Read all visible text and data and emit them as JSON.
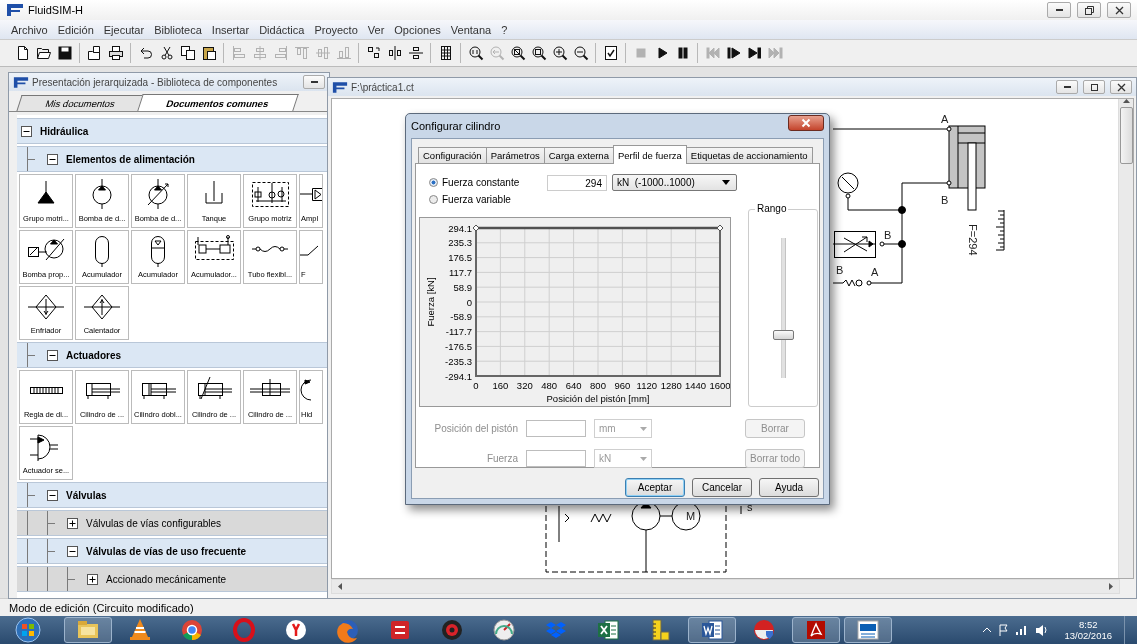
{
  "app": {
    "title": "FluidSIM-H",
    "menu": [
      "Archivo",
      "Edición",
      "Ejecutar",
      "Biblioteca",
      "Insertar",
      "Didáctica",
      "Proyecto",
      "Ver",
      "Opciones",
      "Ventana",
      "?"
    ]
  },
  "toolbar": [
    [
      {
        "kind": "new",
        "disabled": false
      },
      {
        "kind": "open",
        "disabled": false
      },
      {
        "kind": "save",
        "disabled": false
      }
    ],
    [
      {
        "kind": "import",
        "disabled": false
      },
      {
        "kind": "print",
        "disabled": false
      }
    ],
    [
      {
        "kind": "undo",
        "disabled": false
      },
      {
        "kind": "cut",
        "disabled": false
      },
      {
        "kind": "copy",
        "disabled": false
      },
      {
        "kind": "paste",
        "disabled": false
      }
    ],
    [
      {
        "kind": "align-left",
        "disabled": true
      },
      {
        "kind": "align-center",
        "disabled": true
      },
      {
        "kind": "align-right",
        "disabled": true
      },
      {
        "kind": "align-top",
        "disabled": true
      },
      {
        "kind": "align-middle",
        "disabled": true
      },
      {
        "kind": "align-bottom",
        "disabled": true
      }
    ],
    [
      {
        "kind": "rotate",
        "disabled": false
      },
      {
        "kind": "flip-h",
        "disabled": false
      },
      {
        "kind": "flip-v",
        "disabled": false
      }
    ],
    [
      {
        "kind": "grid",
        "disabled": false
      }
    ],
    [
      {
        "kind": "zoom-actual",
        "disabled": false
      },
      {
        "kind": "zoom-previous",
        "disabled": true
      },
      {
        "kind": "zoom-window",
        "disabled": false
      },
      {
        "kind": "zoom-page",
        "disabled": false
      },
      {
        "kind": "zoom-in",
        "disabled": false
      },
      {
        "kind": "zoom-out",
        "disabled": false
      }
    ],
    [
      {
        "kind": "check",
        "disabled": false
      }
    ],
    [
      {
        "kind": "stop",
        "disabled": true
      },
      {
        "kind": "play",
        "disabled": false
      },
      {
        "kind": "pause",
        "disabled": false
      }
    ],
    [
      {
        "kind": "reset",
        "disabled": true
      },
      {
        "kind": "step",
        "disabled": false
      },
      {
        "kind": "step-end",
        "disabled": false
      },
      {
        "kind": "end",
        "disabled": true
      }
    ]
  ],
  "library": {
    "title": "Presentación jerarquizada - Biblioteca de componentes",
    "tabs": [
      {
        "label": "Mis documentos",
        "selected": false
      },
      {
        "label": "Documentos comunes",
        "selected": true
      }
    ],
    "tree": [
      {
        "label": "Hidráulica",
        "expanded": true,
        "children": [
          {
            "label": "Elementos de alimentación",
            "expanded": true,
            "tiles": [
              {
                "label": "Grupo motri...",
                "kind": "power-unit",
                "cut": false
              },
              {
                "label": "Bomba de d...",
                "kind": "pump",
                "cut": false
              },
              {
                "label": "Bomba de d...",
                "kind": "variable-pump",
                "cut": false
              },
              {
                "label": "Tanque",
                "kind": "tank",
                "cut": false
              },
              {
                "label": "Grupo motriz",
                "kind": "power-unit-circuit",
                "cut": false
              },
              {
                "label": "Ampl",
                "kind": "amplifier",
                "cut": true
              },
              {
                "label": "Bomba prop...",
                "kind": "proportional-pump",
                "cut": false
              },
              {
                "label": "Acumulador",
                "kind": "accumulator",
                "cut": false
              },
              {
                "label": "Acumulador",
                "kind": "gas-accumulator",
                "cut": false
              },
              {
                "label": "Acumulador...",
                "kind": "accumulator-circuit",
                "cut": false
              },
              {
                "label": "Tubo flexibl...",
                "kind": "hose",
                "cut": false
              },
              {
                "label": "F",
                "kind": "filter",
                "cut": true
              },
              {
                "label": "Enfriador",
                "kind": "cooler",
                "cut": false
              },
              {
                "label": "Calentador",
                "kind": "heater",
                "cut": false
              }
            ]
          },
          {
            "label": "Actuadores",
            "expanded": true,
            "tiles": [
              {
                "label": "Regla de di...",
                "kind": "ruler",
                "cut": false
              },
              {
                "label": "Cilindro de ...",
                "kind": "cylinder",
                "cut": false
              },
              {
                "label": "Cilindro dobl...",
                "kind": "double-cylinder",
                "cut": false
              },
              {
                "label": "Cilindro de ...",
                "kind": "cushion-cylinder",
                "cut": false
              },
              {
                "label": "Cilindro de ...",
                "kind": "through-rod-cylinder",
                "cut": false
              },
              {
                "label": "Hid",
                "kind": "motor",
                "cut": true
              },
              {
                "label": "Actuador se...",
                "kind": "semi-rotary",
                "cut": false
              }
            ]
          },
          {
            "label": "Válvulas",
            "expanded": true,
            "children": [
              {
                "label": "Válvulas de vías configurables",
                "expanded": false
              },
              {
                "label": "Válvulas de vías de uso frecuente",
                "expanded": true,
                "children": [
                  {
                    "label": "Accionado mecánicamente",
                    "expanded": false
                  }
                ]
              }
            ]
          }
        ]
      }
    ]
  },
  "circuit_window": {
    "title": "F:\\práctica1.ct",
    "labels": [
      "A",
      "B",
      "F=294",
      "B",
      "B",
      "A",
      "M",
      "s"
    ]
  },
  "dialog": {
    "title": "Configurar cilindro",
    "tabs": [
      {
        "label": "Configuración",
        "selected": false
      },
      {
        "label": "Parámetros",
        "selected": false
      },
      {
        "label": "Carga externa",
        "selected": false
      },
      {
        "label": "Perfil de fuerza",
        "selected": true
      },
      {
        "label": "Etiquetas de accionamiento",
        "selected": false
      }
    ],
    "force_mode": [
      {
        "label": "Fuerza constante",
        "selected": true
      },
      {
        "label": "Fuerza variable",
        "selected": false
      }
    ],
    "force_value": "294",
    "unit_select": "kN  (-1000..1000)",
    "chart_data": {
      "type": "line",
      "xlabel": "Posición del pistón [mm]",
      "ylabel": "Fuerza [kN]",
      "x": [
        0,
        1600
      ],
      "series": [
        {
          "color": "#505050",
          "marker": "diamond",
          "values": [
            294,
            294
          ]
        }
      ],
      "grid": true,
      "xlim": [
        0,
        1600
      ],
      "ylim": [
        -294.1,
        294.1
      ],
      "xticks": [
        0,
        160,
        320,
        480,
        640,
        800,
        960,
        1120,
        1280,
        1440,
        1600
      ],
      "yticks": [
        294.1,
        235.3,
        176.5,
        117.7,
        58.9,
        0,
        -58.9,
        -117.7,
        -176.5,
        -235.3,
        -294.1
      ]
    },
    "range": {
      "label": "Rango",
      "level": 0.3
    },
    "point_fields": [
      {
        "label": "Posición del pistón",
        "unit": "mm",
        "disabled": true
      },
      {
        "label": "Fuerza",
        "unit": "kN",
        "disabled": true
      }
    ],
    "point_buttons": [
      {
        "label": "Borrar",
        "disabled": true
      },
      {
        "label": "Borrar todo",
        "disabled": true
      }
    ],
    "buttons": [
      {
        "label": "Aceptar",
        "default": true
      },
      {
        "label": "Cancelar",
        "default": false
      },
      {
        "label": "Ayuda",
        "default": false
      }
    ]
  },
  "status_bar": "Modo de edición (Circuito modificado)",
  "taskbar": {
    "apps": [
      {
        "kind": "folder",
        "running": true
      },
      {
        "kind": "cone",
        "running": false
      },
      {
        "kind": "ring",
        "running": false
      },
      {
        "kind": "red-ring",
        "running": false
      },
      {
        "kind": "red-dot",
        "running": false
      },
      {
        "kind": "fox",
        "running": false
      },
      {
        "kind": "red-square",
        "running": false
      },
      {
        "kind": "gear",
        "running": false
      },
      {
        "kind": "gauge",
        "running": false
      },
      {
        "kind": "box",
        "running": false
      },
      {
        "kind": "green-sheet",
        "running": false
      },
      {
        "kind": "ruler",
        "running": false
      },
      {
        "kind": "blue-sheet",
        "running": true
      },
      {
        "kind": "shield",
        "running": false
      },
      {
        "kind": "dark-red-square",
        "running": true
      },
      {
        "kind": "blue-logo",
        "running": true
      }
    ],
    "time": "8:52",
    "date": "13/02/2016"
  }
}
